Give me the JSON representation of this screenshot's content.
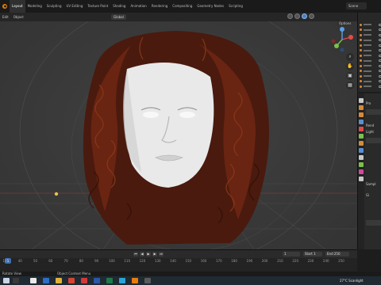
{
  "workspace_tabs": [
    "Layout",
    "Modeling",
    "Sculpting",
    "UV Editing",
    "Texture Paint",
    "Shading",
    "Animation",
    "Rendering",
    "Compositing",
    "Geometry Nodes",
    "Scripting"
  ],
  "active_tab": "Layout",
  "scene_name": "Scene",
  "viewport_header": {
    "menu": [
      "Edit",
      "Object"
    ],
    "transform_orientation": "Global",
    "options_label": "Options"
  },
  "properties_panel": {
    "rows": [
      "Pro",
      "Rend",
      "Light",
      "Sampl",
      "Gi"
    ]
  },
  "timeline": {
    "current_frame": "1",
    "start_label": "Start",
    "start_value": "1",
    "end_label": "End",
    "end_value": "250",
    "ticks": [
      "10",
      "40",
      "50",
      "60",
      "70",
      "80",
      "90",
      "100",
      "110",
      "120",
      "130",
      "140",
      "150",
      "160",
      "170",
      "180",
      "190",
      "200",
      "210",
      "220",
      "230",
      "240",
      "250"
    ]
  },
  "status_bar": {
    "left_text": "Rotate View",
    "mid_text": "Object Context Menu"
  },
  "taskbar": {
    "weather": "27°C  Scanlight"
  },
  "colors": {
    "accent_blue": "#4a7fc0",
    "hair": "#5a2012",
    "skin": "#e7e7e7",
    "viewport_bg": "#393939"
  },
  "icons": [
    "blender-logo-icon",
    "gizmo-axis-icon",
    "zoom-icon",
    "hand-pan-icon",
    "camera-view-icon",
    "grid-toggle-icon"
  ]
}
